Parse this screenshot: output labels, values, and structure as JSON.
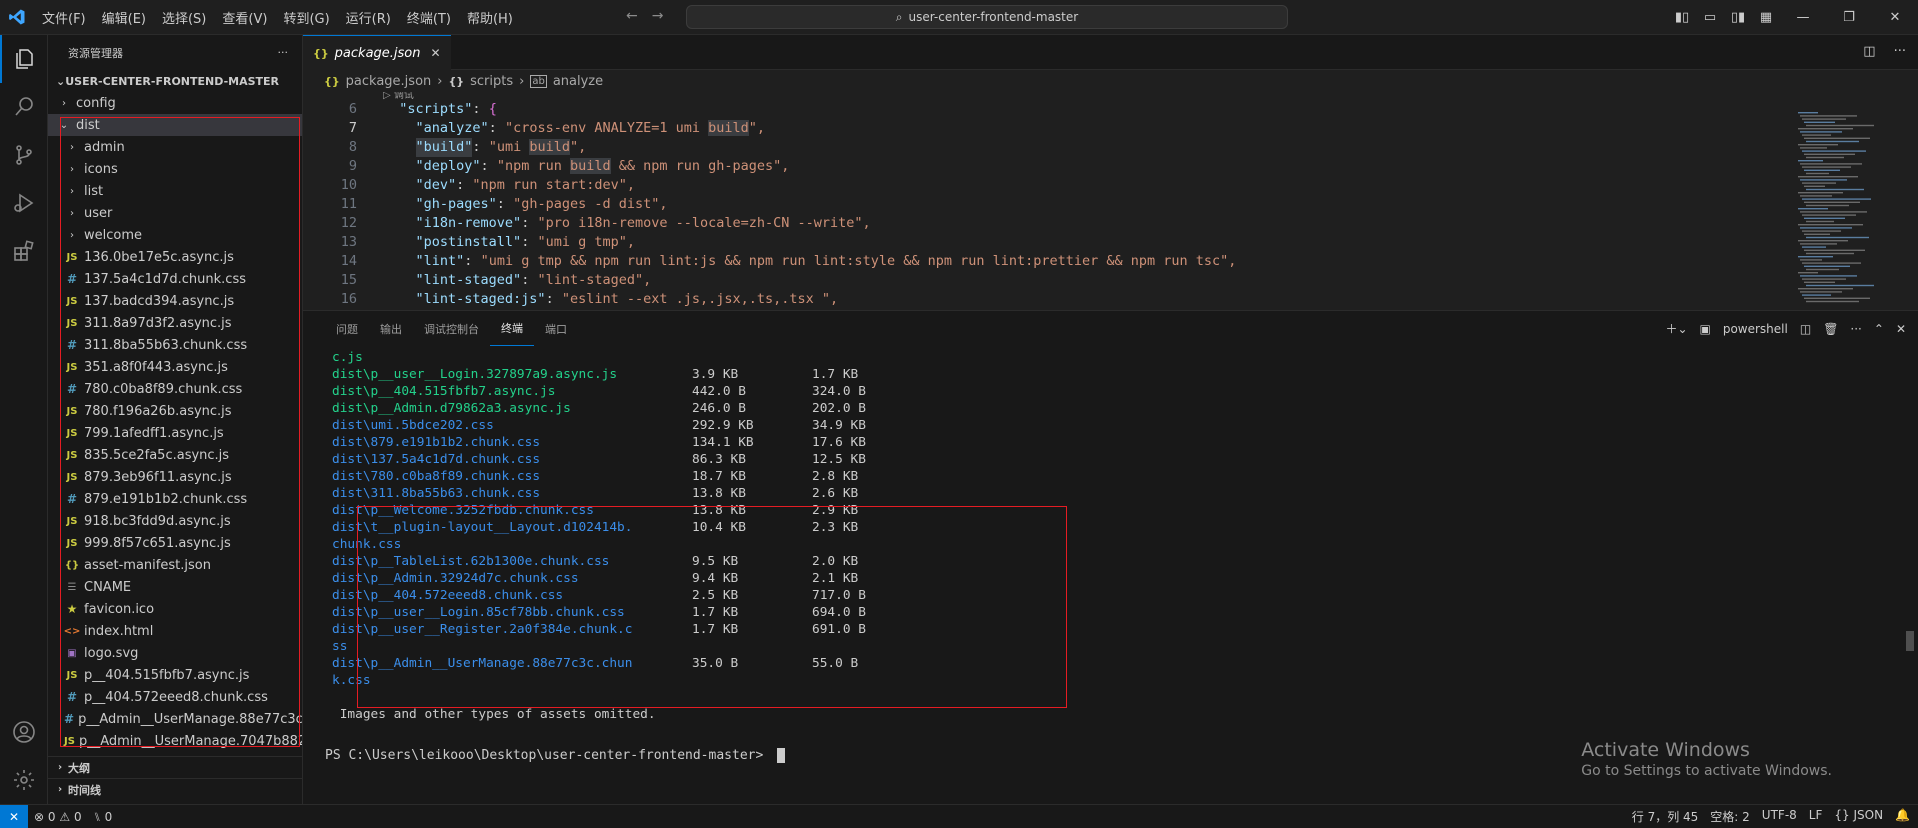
{
  "titlebar": {
    "menu": [
      "文件(F)",
      "编辑(E)",
      "选择(S)",
      "查看(V)",
      "转到(G)",
      "运行(R)",
      "终端(T)",
      "帮助(H)"
    ],
    "search_text": "user-center-frontend-master"
  },
  "sidebar": {
    "title": "资源管理器",
    "root": "USER-CENTER-FRONTEND-MASTER",
    "items": [
      {
        "label": "config",
        "kind": "folder-closed",
        "depth": 0
      },
      {
        "label": "dist",
        "kind": "folder-open",
        "depth": 0
      },
      {
        "label": "admin",
        "kind": "folder-closed",
        "depth": 1
      },
      {
        "label": "icons",
        "kind": "folder-closed",
        "depth": 1
      },
      {
        "label": "list",
        "kind": "folder-closed",
        "depth": 1
      },
      {
        "label": "user",
        "kind": "folder-closed",
        "depth": 1
      },
      {
        "label": "welcome",
        "kind": "folder-closed",
        "depth": 1
      },
      {
        "label": "136.0be17e5c.async.js",
        "kind": "js",
        "depth": 1
      },
      {
        "label": "137.5a4c1d7d.chunk.css",
        "kind": "css",
        "depth": 1
      },
      {
        "label": "137.badcd394.async.js",
        "kind": "js",
        "depth": 1
      },
      {
        "label": "311.8a97d3f2.async.js",
        "kind": "js",
        "depth": 1
      },
      {
        "label": "311.8ba55b63.chunk.css",
        "kind": "css",
        "depth": 1
      },
      {
        "label": "351.a8f0f443.async.js",
        "kind": "js",
        "depth": 1
      },
      {
        "label": "780.c0ba8f89.chunk.css",
        "kind": "css",
        "depth": 1
      },
      {
        "label": "780.f196a26b.async.js",
        "kind": "js",
        "depth": 1
      },
      {
        "label": "799.1afedff1.async.js",
        "kind": "js",
        "depth": 1
      },
      {
        "label": "835.5ce2fa5c.async.js",
        "kind": "js",
        "depth": 1
      },
      {
        "label": "879.3eb96f11.async.js",
        "kind": "js",
        "depth": 1
      },
      {
        "label": "879.e191b1b2.chunk.css",
        "kind": "css",
        "depth": 1
      },
      {
        "label": "918.bc3fdd9d.async.js",
        "kind": "js",
        "depth": 1
      },
      {
        "label": "999.8f57c651.async.js",
        "kind": "js",
        "depth": 1
      },
      {
        "label": "asset-manifest.json",
        "kind": "json",
        "depth": 1
      },
      {
        "label": "CNAME",
        "kind": "cname",
        "depth": 1
      },
      {
        "label": "favicon.ico",
        "kind": "fav",
        "depth": 1
      },
      {
        "label": "index.html",
        "kind": "html",
        "depth": 1
      },
      {
        "label": "logo.svg",
        "kind": "svg",
        "depth": 1
      },
      {
        "label": "p__404.515fbfb7.async.js",
        "kind": "js",
        "depth": 1
      },
      {
        "label": "p__404.572eeed8.chunk.css",
        "kind": "css",
        "depth": 1
      },
      {
        "label": "p__Admin__UserManage.88e77c3c...",
        "kind": "css",
        "depth": 1
      },
      {
        "label": "p__Admin__UserManage.7047b882...",
        "kind": "js",
        "depth": 1
      }
    ],
    "outline": "大纲",
    "timeline": "时间线"
  },
  "editor": {
    "tab_label": "package.json",
    "tab_icon": "{}",
    "breadcrumb": [
      "package.json",
      "scripts",
      "analyze"
    ],
    "codelens": "调试",
    "lines": [
      {
        "n": "6",
        "indent": "  ",
        "key": "\"scripts\"",
        "rest": ": ",
        "brace": "{",
        "val": "",
        "hl": ""
      },
      {
        "n": "7",
        "indent": "    ",
        "key": "\"analyze\"",
        "rest": ": ",
        "brace": "",
        "val": "\"cross-env ANALYZE=1 umi build\",",
        "hl": "build",
        "cur": true
      },
      {
        "n": "8",
        "indent": "    ",
        "key": "\"build\"",
        "rest": ": ",
        "brace": "",
        "val": "\"umi build\",",
        "hl": "build"
      },
      {
        "n": "9",
        "indent": "    ",
        "key": "\"deploy\"",
        "rest": ": ",
        "brace": "",
        "val": "\"npm run build && npm run gh-pages\",",
        "hl": "build"
      },
      {
        "n": "10",
        "indent": "    ",
        "key": "\"dev\"",
        "rest": ": ",
        "brace": "",
        "val": "\"npm run start:dev\",",
        "hl": ""
      },
      {
        "n": "11",
        "indent": "    ",
        "key": "\"gh-pages\"",
        "rest": ": ",
        "brace": "",
        "val": "\"gh-pages -d dist\",",
        "hl": ""
      },
      {
        "n": "12",
        "indent": "    ",
        "key": "\"i18n-remove\"",
        "rest": ": ",
        "brace": "",
        "val": "\"pro i18n-remove --locale=zh-CN --write\",",
        "hl": ""
      },
      {
        "n": "13",
        "indent": "    ",
        "key": "\"postinstall\"",
        "rest": ": ",
        "brace": "",
        "val": "\"umi g tmp\",",
        "hl": ""
      },
      {
        "n": "14",
        "indent": "    ",
        "key": "\"lint\"",
        "rest": ": ",
        "brace": "",
        "val": "\"umi g tmp && npm run lint:js && npm run lint:style && npm run lint:prettier && npm run tsc\",",
        "hl": ""
      },
      {
        "n": "15",
        "indent": "    ",
        "key": "\"lint-staged\"",
        "rest": ": ",
        "brace": "",
        "val": "\"lint-staged\",",
        "hl": ""
      },
      {
        "n": "16",
        "indent": "    ",
        "key": "\"lint-staged:js\"",
        "rest": ": ",
        "brace": "",
        "val": "\"eslint --ext .js,.jsx,.ts,.tsx \",",
        "hl": ""
      }
    ]
  },
  "panel": {
    "tabs": [
      "问题",
      "输出",
      "调试控制台",
      "终端",
      "端口"
    ],
    "active_tab": "终端",
    "shell": "powershell",
    "terminal_lines": [
      {
        "file": "c.js",
        "size": "",
        "gzip": "",
        "color": "green"
      },
      {
        "file": "dist\\p__user__Login.327897a9.async.js",
        "size": "3.9 KB",
        "gzip": "1.7 KB",
        "color": "green"
      },
      {
        "file": "dist\\p__404.515fbfb7.async.js",
        "size": "442.0 B",
        "gzip": "324.0 B",
        "color": "green"
      },
      {
        "file": "dist\\p__Admin.d79862a3.async.js",
        "size": "246.0 B",
        "gzip": "202.0 B",
        "color": "green"
      },
      {
        "file": "dist\\umi.5bdce202.css",
        "size": "292.9 KB",
        "gzip": "34.9 KB",
        "color": "blue"
      },
      {
        "file": "dist\\879.e191b1b2.chunk.css",
        "size": "134.1 KB",
        "gzip": "17.6 KB",
        "color": "blue"
      },
      {
        "file": "dist\\137.5a4c1d7d.chunk.css",
        "size": "86.3 KB",
        "gzip": "12.5 KB",
        "color": "blue"
      },
      {
        "file": "dist\\780.c0ba8f89.chunk.css",
        "size": "18.7 KB",
        "gzip": "2.8 KB",
        "color": "blue"
      },
      {
        "file": "dist\\311.8ba55b63.chunk.css",
        "size": "13.8 KB",
        "gzip": "2.6 KB",
        "color": "blue"
      },
      {
        "file": "dist\\p__Welcome.3252fbdb.chunk.css",
        "size": "13.8 KB",
        "gzip": "2.9 KB",
        "color": "blue"
      },
      {
        "file": "dist\\t__plugin-layout__Layout.d102414b.",
        "size": "10.4 KB",
        "gzip": "2.3 KB",
        "color": "blue"
      },
      {
        "file": "chunk.css",
        "size": "",
        "gzip": "",
        "color": "blue"
      },
      {
        "file": "dist\\p__TableList.62b1300e.chunk.css",
        "size": "9.5 KB",
        "gzip": "2.0 KB",
        "color": "blue"
      },
      {
        "file": "dist\\p__Admin.32924d7c.chunk.css",
        "size": "9.4 KB",
        "gzip": "2.1 KB",
        "color": "blue"
      },
      {
        "file": "dist\\p__404.572eeed8.chunk.css",
        "size": "2.5 KB",
        "gzip": "717.0 B",
        "color": "blue"
      },
      {
        "file": "dist\\p__user__Login.85cf78bb.chunk.css",
        "size": "1.7 KB",
        "gzip": "694.0 B",
        "color": "blue"
      },
      {
        "file": "dist\\p__user__Register.2a0f384e.chunk.c",
        "size": "1.7 KB",
        "gzip": "691.0 B",
        "color": "blue"
      },
      {
        "file": "ss",
        "size": "",
        "gzip": "",
        "color": "blue"
      },
      {
        "file": "dist\\p__Admin__UserManage.88e77c3c.chun",
        "size": "35.0 B",
        "gzip": "55.0 B",
        "color": "blue"
      },
      {
        "file": "k.css",
        "size": "",
        "gzip": "",
        "color": "blue"
      },
      {
        "file": "",
        "size": "",
        "gzip": "",
        "color": "plain"
      },
      {
        "file": " Images and other types of assets omitted.",
        "size": "",
        "gzip": "",
        "color": "plain"
      }
    ],
    "prompt": "PS C:\\Users\\leikooo\\Desktop\\user-center-frontend-master> ",
    "activate_title": "Activate Windows",
    "activate_sub": "Go to Settings to activate Windows."
  },
  "statusbar": {
    "errors": "0",
    "warnings": "0",
    "ports": "0",
    "position": "行 7，列 45",
    "spaces": "空格: 2",
    "encoding": "UTF-8",
    "eol": "LF",
    "language": "JSON"
  },
  "colors": {
    "accent": "#0078d4",
    "highlight_box": "#e51c23"
  }
}
